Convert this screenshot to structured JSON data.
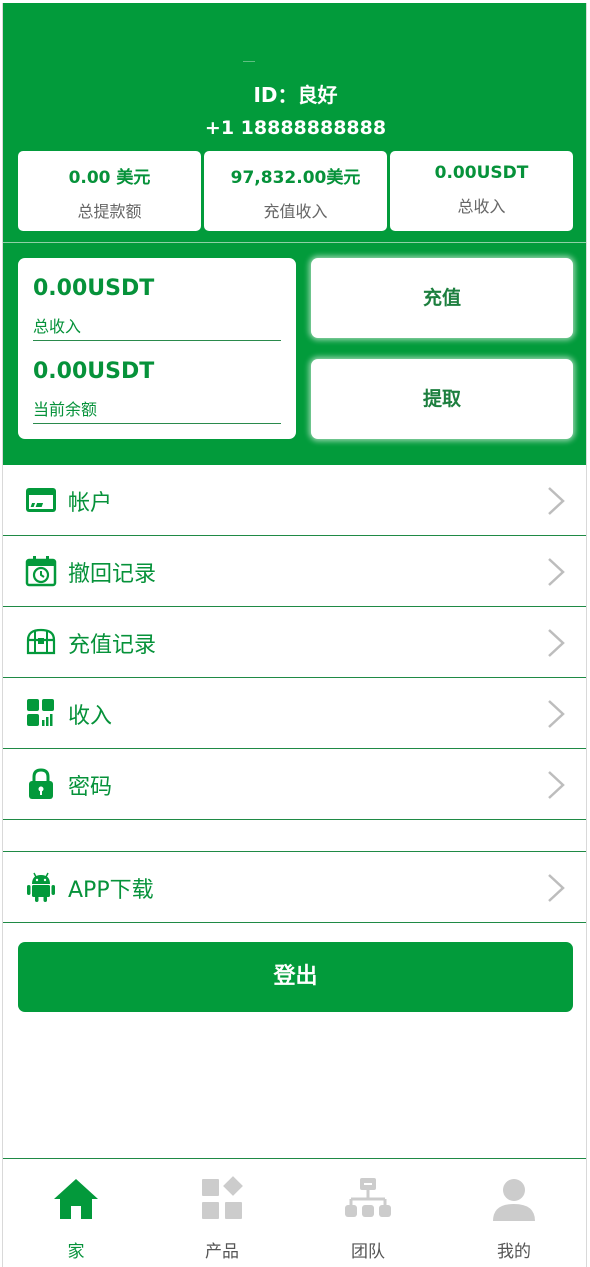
{
  "profile": {
    "id_line": "ID：良好",
    "phone": "+1 18888888888"
  },
  "stats": [
    {
      "value": "0.00 美元",
      "label": "总提款额"
    },
    {
      "value": "97,832.00美元",
      "label": "充值收入"
    },
    {
      "value": "0.00USDT",
      "label": "总收入"
    }
  ],
  "balance": {
    "income_value": "0.00USDT",
    "income_label": "总收入",
    "current_value": "0.00USDT",
    "current_label": "当前余额"
  },
  "actions": {
    "recharge": "充值",
    "withdraw": "提取"
  },
  "menu": [
    {
      "label": "帐户",
      "icon": "card-icon"
    },
    {
      "label": "撤回记录",
      "icon": "calendar-clock-icon"
    },
    {
      "label": "充值记录",
      "icon": "treasure-chest-icon"
    },
    {
      "label": "收入",
      "icon": "grid-chart-icon"
    },
    {
      "label": "密码",
      "icon": "lock-icon"
    }
  ],
  "app_download": {
    "label": "APP下载",
    "icon": "android-icon"
  },
  "logout": "登出",
  "tabs": [
    {
      "label": "家",
      "icon": "home-icon",
      "active": true
    },
    {
      "label": "产品",
      "icon": "products-icon",
      "active": false
    },
    {
      "label": "团队",
      "icon": "team-icon",
      "active": false
    },
    {
      "label": "我的",
      "icon": "user-icon",
      "active": false
    }
  ],
  "colors": {
    "brand": "#029b3b",
    "inactive_icon": "#cccccc"
  }
}
